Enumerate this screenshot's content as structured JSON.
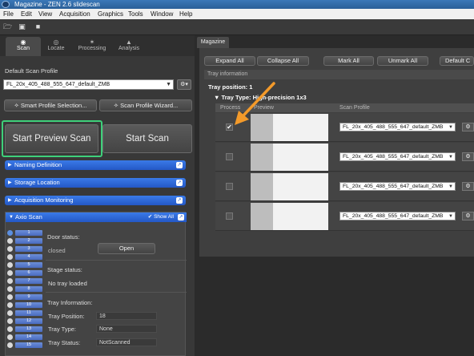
{
  "window": {
    "title": "Magazine - ZEN 2.6 slidescan"
  },
  "menu": [
    "File",
    "Edit",
    "View",
    "Acquisition",
    "Graphics",
    "Tools",
    "Window",
    "Help"
  ],
  "left_tabs": [
    {
      "label": "Scan",
      "icon": "scan-icon"
    },
    {
      "label": "Locate",
      "icon": "locate-icon"
    },
    {
      "label": "Processing",
      "icon": "processing-icon"
    },
    {
      "label": "Analysis",
      "icon": "analysis-icon"
    }
  ],
  "scan_profile": {
    "label": "Default Scan Profile",
    "value": "FL_20x_405_488_555_647_default_ZMB",
    "smart_button": "Smart Profile Selection...",
    "wizard_button": "Scan Profile Wizard..."
  },
  "scan_buttons": {
    "preview": "Start Preview Scan",
    "start": "Start Scan"
  },
  "sections": [
    "Naming Definition",
    "Storage Location",
    "Acquisition Monitoring"
  ],
  "axio": {
    "title": "Axio Scan",
    "show_all": "Show All",
    "positions": [
      "1",
      "2",
      "3",
      "4",
      "5",
      "6",
      "7",
      "8",
      "9",
      "10",
      "11",
      "12",
      "13",
      "14",
      "15"
    ],
    "door_status_label": "Door status:",
    "door_status_value": "closed",
    "open_button": "Open",
    "stage_status_label": "Stage status:",
    "stage_status_value": "No tray loaded",
    "tray_info_label": "Tray Information:",
    "tray_position_label": "Tray Position:",
    "tray_position_value": "18",
    "tray_type_label": "Tray Type:",
    "tray_type_value": "None",
    "tray_status_label": "Tray Status:",
    "tray_status_value": "NotScanned"
  },
  "magazine": {
    "tab": "Magazine",
    "buttons": {
      "expand_all": "Expand All",
      "collapse_all": "Collapse All",
      "mark_all": "Mark All",
      "unmark_all": "Unmark All",
      "default": "Default C"
    },
    "tray_information": "Tray information",
    "tray_position": "Tray position:  1",
    "tray_type": "Tray Type:  High-precision 1x3",
    "columns": {
      "process": "Process",
      "preview": "Preview",
      "scan_profile": "Scan Profile"
    },
    "rows": [
      {
        "checked": true,
        "profile": "FL_20x_405_488_555_647_default_ZMB"
      },
      {
        "checked": false,
        "profile": "FL_20x_405_488_555_647_default_ZMB"
      },
      {
        "checked": false,
        "profile": "FL_20x_405_488_555_647_default_ZMB"
      },
      {
        "checked": false,
        "profile": "FL_20x_405_488_555_647_default_ZMB"
      }
    ]
  },
  "colors": {
    "accent_blue": "#2f68d6",
    "highlight_green": "#3ed07a",
    "arrow_orange": "#f39a2a"
  }
}
